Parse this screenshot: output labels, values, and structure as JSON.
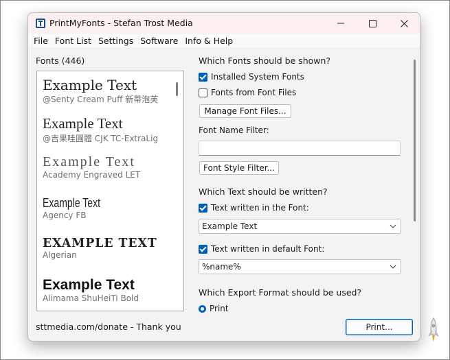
{
  "window": {
    "title": "PrintMyFonts - Stefan Trost Media"
  },
  "menubar": {
    "items": [
      "File",
      "Font List",
      "Settings",
      "Software",
      "Info & Help"
    ]
  },
  "fonts_panel": {
    "title": "Fonts (446)",
    "entries": [
      {
        "sample": "Example Text",
        "name": "@Senty Cream Puff 新蒂泡芙"
      },
      {
        "sample": "Example Text",
        "name": "@吉果哇圓體 CJK TC-ExtraLig"
      },
      {
        "sample": "Example Text",
        "name": "Academy Engraved LET"
      },
      {
        "sample": "Example Text",
        "name": "Agency FB"
      },
      {
        "sample": "EXAMPLE TEXT",
        "name": "Algerian"
      },
      {
        "sample": "Example Text",
        "name": "Alimama ShuHeiTi Bold"
      }
    ]
  },
  "fonts_shown": {
    "title": "Which Fonts should be shown?",
    "installed_label": "Installed System Fonts",
    "installed_checked": true,
    "files_label": "Fonts from Font Files",
    "files_checked": false,
    "manage_button": "Manage Font Files...",
    "filter_label": "Font Name Filter:",
    "filter_value": "",
    "style_button": "Font Style Filter..."
  },
  "text_written": {
    "title": "Which Text should be written?",
    "in_font_label": "Text written in the Font:",
    "in_font_checked": true,
    "in_font_value": "Example Text",
    "default_label": "Text written in default Font:",
    "default_checked": true,
    "default_value": "%name%"
  },
  "export": {
    "title": "Which Export Format should be used?",
    "print_option": "Print",
    "print_selected": true
  },
  "footer": {
    "donate_text": "sttmedia.com/donate - Thank you",
    "print_button": "Print..."
  },
  "colors": {
    "accent": "#005fb8",
    "titlebar": "#fcefef",
    "window_bg": "#f3f3f3"
  }
}
